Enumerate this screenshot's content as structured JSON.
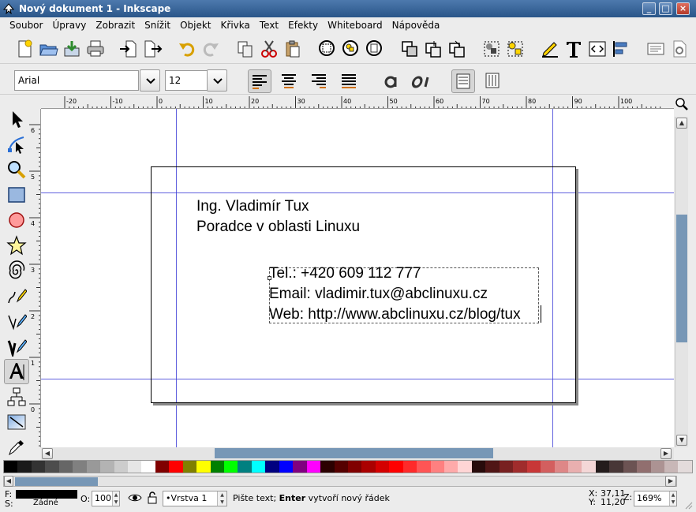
{
  "window": {
    "title": "Nový dokument 1 - Inkscape",
    "buttons": {
      "minimize": "_",
      "maximize": "□",
      "close": "×"
    }
  },
  "menu": [
    {
      "label": "Soubor"
    },
    {
      "label": "Úpravy"
    },
    {
      "label": "Zobrazit"
    },
    {
      "label": "Snížit"
    },
    {
      "label": "Objekt"
    },
    {
      "label": "Křivka"
    },
    {
      "label": "Text"
    },
    {
      "label": "Efekty"
    },
    {
      "label": "Whiteboard"
    },
    {
      "label": "Nápověda"
    }
  ],
  "text_toolbar": {
    "font_family": "Arial",
    "font_size": "12",
    "active_align": "align-left"
  },
  "ruler": {
    "h_labels": [
      "-20",
      "-10",
      "0",
      "10",
      "20",
      "30",
      "40",
      "50",
      "60",
      "70",
      "80",
      "90",
      "100"
    ],
    "v_labels": [
      "6",
      "5",
      "4",
      "3",
      "2",
      "1",
      "0"
    ]
  },
  "document": {
    "line1": "Ing. Vladimír Tux",
    "line2": "Poradce v oblasti Linuxu",
    "tel": "Tel.: +420 609 112 777",
    "email": "Email: vladimir.tux@abclinuxu.cz",
    "web": "Web: http://www.abclinuxu.cz/blog/tux"
  },
  "palette": [
    "#000000",
    "#1a1a1a",
    "#333333",
    "#4d4d4d",
    "#666666",
    "#808080",
    "#999999",
    "#b3b3b3",
    "#cccccc",
    "#e6e6e6",
    "#ffffff",
    "#800000",
    "#ff0000",
    "#808000",
    "#ffff00",
    "#008000",
    "#00ff00",
    "#008080",
    "#00ffff",
    "#000080",
    "#0000ff",
    "#800080",
    "#ff00ff",
    "#2b0000",
    "#550000",
    "#800000",
    "#aa0000",
    "#d40000",
    "#ff0000",
    "#ff2a2a",
    "#ff5555",
    "#ff8080",
    "#ffaaaa",
    "#ffd5d5",
    "#280b0b",
    "#501616",
    "#782121",
    "#a02c2c",
    "#c83737",
    "#d35f5f",
    "#de8787",
    "#e9afaf",
    "#f4d7d7",
    "#241c1c",
    "#483737",
    "#6c5353",
    "#916f6f",
    "#ac9393",
    "#c8b7b7",
    "#e3dbdb"
  ],
  "status": {
    "fill_label": "F:",
    "stroke_label": "S:",
    "fill_color": "#000000",
    "stroke_value": "Žádné",
    "opacity_label": "O:",
    "opacity": "100",
    "layer": "•Vrstva 1",
    "message_prefix": "Pište text; ",
    "message_key": "Enter",
    "message_suffix": " vytvoří nový řádek",
    "x_label": "X:",
    "x": "37,11",
    "y_label": "Y:",
    "y": "11,20",
    "zoom_label": "Z:",
    "zoom": "169%"
  }
}
